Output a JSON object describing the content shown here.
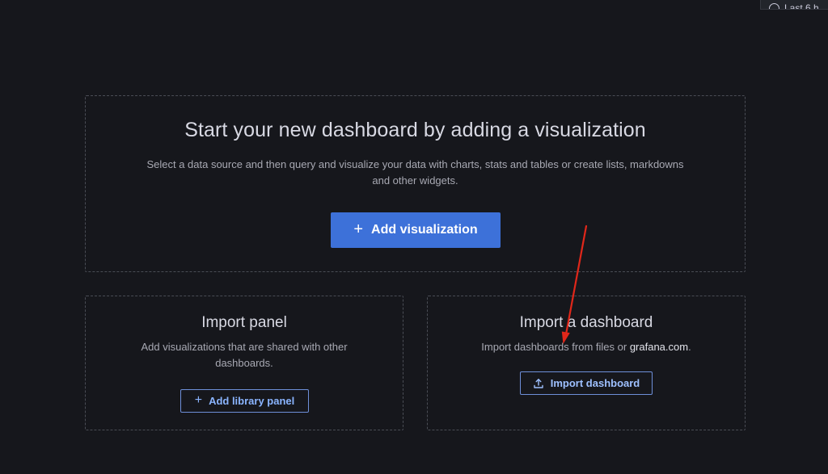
{
  "topbar": {
    "time_range_label": "Last 6 h"
  },
  "empty_state": {
    "title": "Start your new dashboard by adding a visualization",
    "description": "Select a data source and then query and visualize your data with charts, stats and tables or create lists, markdowns and other widgets.",
    "add_visualization_label": "Add visualization"
  },
  "import_panel": {
    "title": "Import panel",
    "description": "Add visualizations that are shared with other dashboards.",
    "button_label": "Add library panel"
  },
  "import_dashboard": {
    "title": "Import a dashboard",
    "description_prefix": "Import dashboards from files or ",
    "description_link": "grafana.com",
    "description_suffix": ".",
    "button_label": "Import dashboard"
  },
  "icons": {
    "time_picker": "clock-icon",
    "add": "plus-icon",
    "import": "upload-icon"
  },
  "colors": {
    "background": "#16171c",
    "primary": "#3d71d9",
    "outline_text": "#8ab4ff",
    "annotation": "#e0271a"
  }
}
